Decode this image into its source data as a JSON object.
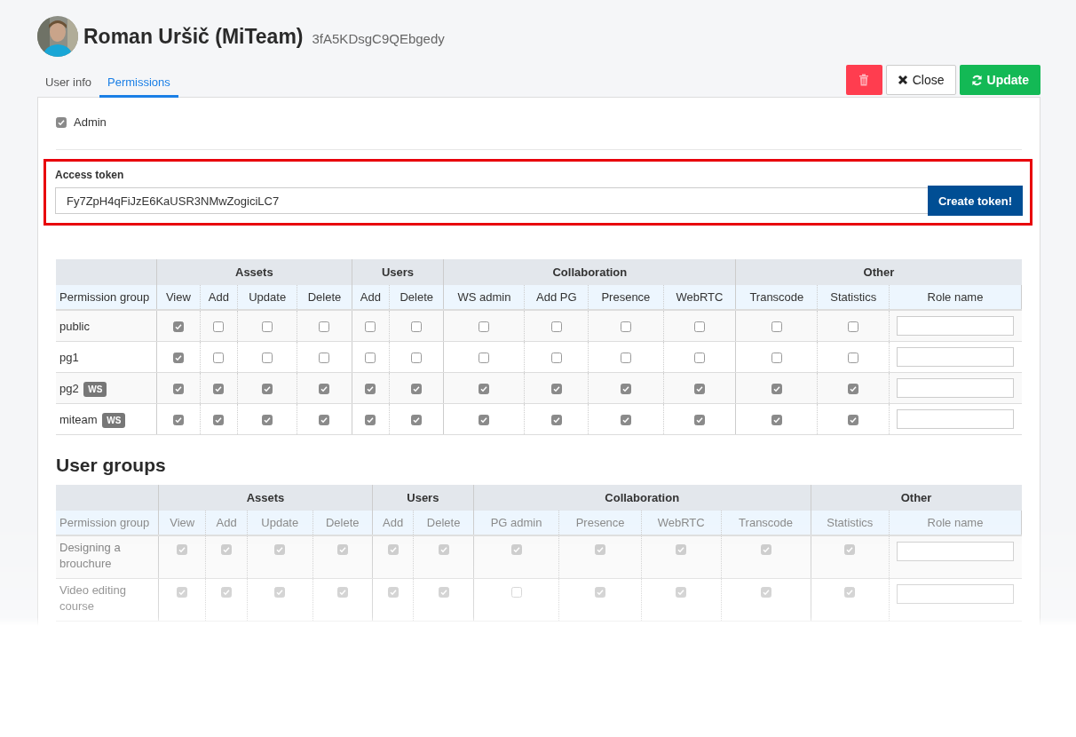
{
  "user": {
    "name": "Roman Uršič (MiTeam)",
    "id": "3fA5KDsgC9QEbgedy"
  },
  "tabs": [
    {
      "label": "User info",
      "selected": false
    },
    {
      "label": "Permissions",
      "selected": true
    }
  ],
  "buttons": [
    {
      "kind": "delete"
    },
    {
      "kind": "close",
      "label": "Close"
    },
    {
      "kind": "update",
      "label": "Update"
    }
  ],
  "admin": {
    "label": "Admin",
    "checked": true
  },
  "access_token": {
    "label": "Access token",
    "value": "Fy7ZpH4qFiJzE6KaUSR3NMwZogiciLC7",
    "button": "Create token!"
  },
  "permissions_table": {
    "first_column": "Permission group",
    "disabled": false,
    "groups": [
      {
        "label": "Assets",
        "columns": [
          "View",
          "Add",
          "Update",
          "Delete"
        ]
      },
      {
        "label": "Users",
        "columns": [
          "Add",
          "Delete"
        ]
      },
      {
        "label": "Collaboration",
        "columns": [
          "WS admin",
          "Add PG",
          "Presence",
          "WebRTC"
        ]
      },
      {
        "label": "Other",
        "columns": [
          "Transcode",
          "Statistics",
          "Role name"
        ]
      }
    ],
    "rows": [
      {
        "name": "public",
        "checks": [
          true,
          false,
          false,
          false,
          false,
          false,
          false,
          false,
          false,
          false,
          false,
          false
        ]
      },
      {
        "name": "pg1",
        "checks": [
          true,
          false,
          false,
          false,
          false,
          false,
          false,
          false,
          false,
          false,
          false,
          false
        ]
      },
      {
        "name": "pg2",
        "badge": "WS",
        "checks": [
          true,
          true,
          true,
          true,
          true,
          true,
          true,
          true,
          true,
          true,
          true,
          true
        ]
      },
      {
        "name": "miteam",
        "badge": "WS",
        "checks": [
          true,
          true,
          true,
          true,
          true,
          true,
          true,
          true,
          true,
          true,
          true,
          true
        ]
      }
    ]
  },
  "user_groups": {
    "title": "User groups",
    "first_column": "Permission group",
    "disabled": true,
    "groups": [
      {
        "label": "Assets",
        "columns": [
          "View",
          "Add",
          "Update",
          "Delete"
        ]
      },
      {
        "label": "Users",
        "columns": [
          "Add",
          "Delete"
        ]
      },
      {
        "label": "Collaboration",
        "columns": [
          "PG admin",
          "Presence",
          "WebRTC",
          "Transcode"
        ]
      },
      {
        "label": "Other",
        "columns": [
          "Statistics",
          "Role name"
        ]
      }
    ],
    "rows": [
      {
        "name": "Designing a brouchure",
        "checks": [
          true,
          true,
          true,
          true,
          true,
          true,
          true,
          true,
          true,
          true,
          true
        ]
      },
      {
        "name": "Video editing course",
        "checks": [
          true,
          true,
          true,
          true,
          true,
          true,
          false,
          true,
          true,
          true,
          true
        ]
      }
    ]
  }
}
